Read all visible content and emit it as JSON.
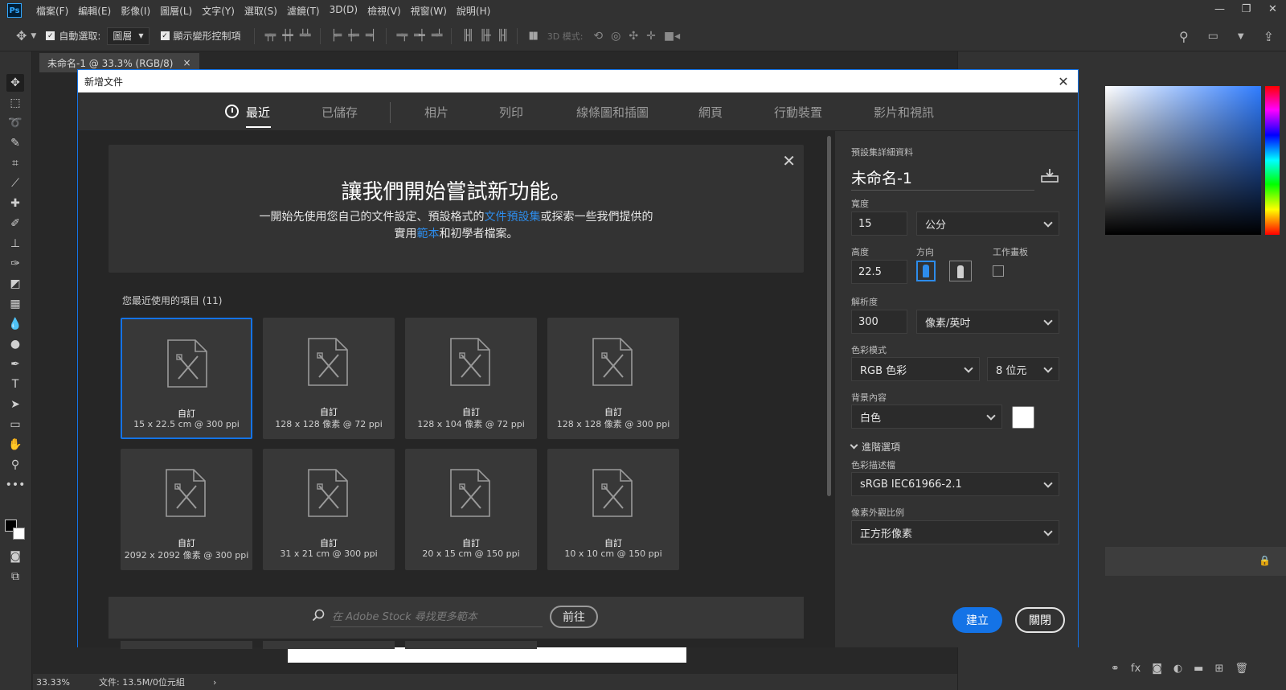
{
  "app": {
    "logo": "Ps"
  },
  "menu": [
    "檔案(F)",
    "編輯(E)",
    "影像(I)",
    "圖層(L)",
    "文字(Y)",
    "選取(S)",
    "濾鏡(T)",
    "3D(D)",
    "檢視(V)",
    "視窗(W)",
    "說明(H)"
  ],
  "window_controls": {
    "minimize": "—",
    "restore": "❐",
    "close": "✕"
  },
  "options_bar": {
    "auto_select_label": "自動選取:",
    "auto_select_value": "圖層",
    "show_transform_label": "顯示變形控制項",
    "mode_3d_label": "3D 模式:"
  },
  "document": {
    "tab_title": "未命名-1 @ 33.3% (RGB/8)",
    "tab_close": "×",
    "zoom": "33.33%",
    "file_info": "文件: 13.5M/0位元組",
    "status_arrow": "›"
  },
  "modal": {
    "title": "新增文件",
    "close": "✕",
    "tabs": [
      "最近",
      "已儲存",
      "相片",
      "列印",
      "線條圖和插圖",
      "網頁",
      "行動裝置",
      "影片和視訊"
    ],
    "active_tab": "最近",
    "welcome": {
      "close": "✕",
      "title": "讓我們開始嘗試新功能。",
      "body_1": "一開始先使用您自己的文件設定、預設格式的",
      "link_1": "文件預設集",
      "body_2": "或探索一些我們提供的",
      "body_3": "實用",
      "link_2": "範本",
      "body_4": "和初學者檔案。"
    },
    "recent_label": "您最近使用的項目 (11)",
    "recent_items": [
      {
        "name": "自訂",
        "size": "15 x 22.5 cm @ 300 ppi"
      },
      {
        "name": "自訂",
        "size": "128 x 128 像素 @ 72 ppi"
      },
      {
        "name": "自訂",
        "size": "128 x 104 像素 @ 72 ppi"
      },
      {
        "name": "自訂",
        "size": "128 x 128 像素 @ 300 ppi"
      },
      {
        "name": "自訂",
        "size": "2092 x 2092 像素 @ 300 ppi"
      },
      {
        "name": "自訂",
        "size": "31 x 21 cm @ 300 ppi"
      },
      {
        "name": "自訂",
        "size": "20 x 15 cm @ 150 ppi"
      },
      {
        "name": "自訂",
        "size": "10 x 10 cm @ 150 ppi"
      }
    ],
    "stock": {
      "placeholder": "在 Adobe Stock 尋找更多範本",
      "go_label": "前往"
    },
    "preset": {
      "section_label": "預設集詳細資料",
      "name": "未命名-1",
      "width_label": "寬度",
      "width_value": "15",
      "width_unit": "公分",
      "height_label": "高度",
      "height_value": "22.5",
      "orientation_label": "方向",
      "artboard_label": "工作畫板",
      "resolution_label": "解析度",
      "resolution_value": "300",
      "resolution_unit": "像素/英吋",
      "color_mode_label": "色彩模式",
      "color_mode_value": "RGB 色彩",
      "bit_depth_value": "8 位元",
      "background_label": "背景內容",
      "background_value": "白色",
      "background_swatch": "#ffffff",
      "advanced_label": "進階選項",
      "profile_label": "色彩描述檔",
      "profile_value": "sRGB IEC61966-2.1",
      "pixel_aspect_label": "像素外觀比例",
      "pixel_aspect_value": "正方形像素",
      "create_label": "建立",
      "close_label": "關閉"
    }
  },
  "colors": {
    "accent": "#1473e6",
    "link": "#2d8ceb",
    "panel": "#323232",
    "dialog_bg": "#262626"
  }
}
